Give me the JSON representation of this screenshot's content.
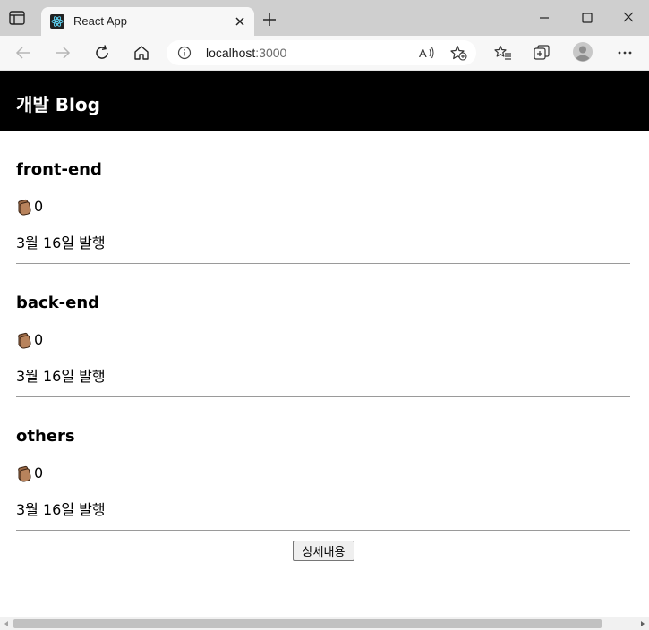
{
  "browser": {
    "tab": {
      "title": "React App"
    },
    "address": {
      "host": "localhost",
      "port": ":3000"
    }
  },
  "app": {
    "title": "개발 Blog",
    "posts": [
      {
        "title": "front-end",
        "likes": "0",
        "date": "3월 16일 발행"
      },
      {
        "title": "back-end",
        "likes": "0",
        "date": "3월 16일 발행"
      },
      {
        "title": "others",
        "likes": "0",
        "date": "3월 16일 발행"
      }
    ],
    "detail_button": "상세내용"
  },
  "icons": {
    "like": "clapping-hands-icon",
    "tab_favicon": "react-logo-icon"
  },
  "colors": {
    "header_bg": "#000000",
    "header_text": "#ffffff",
    "tabstrip_bg": "#cfcfcf"
  }
}
